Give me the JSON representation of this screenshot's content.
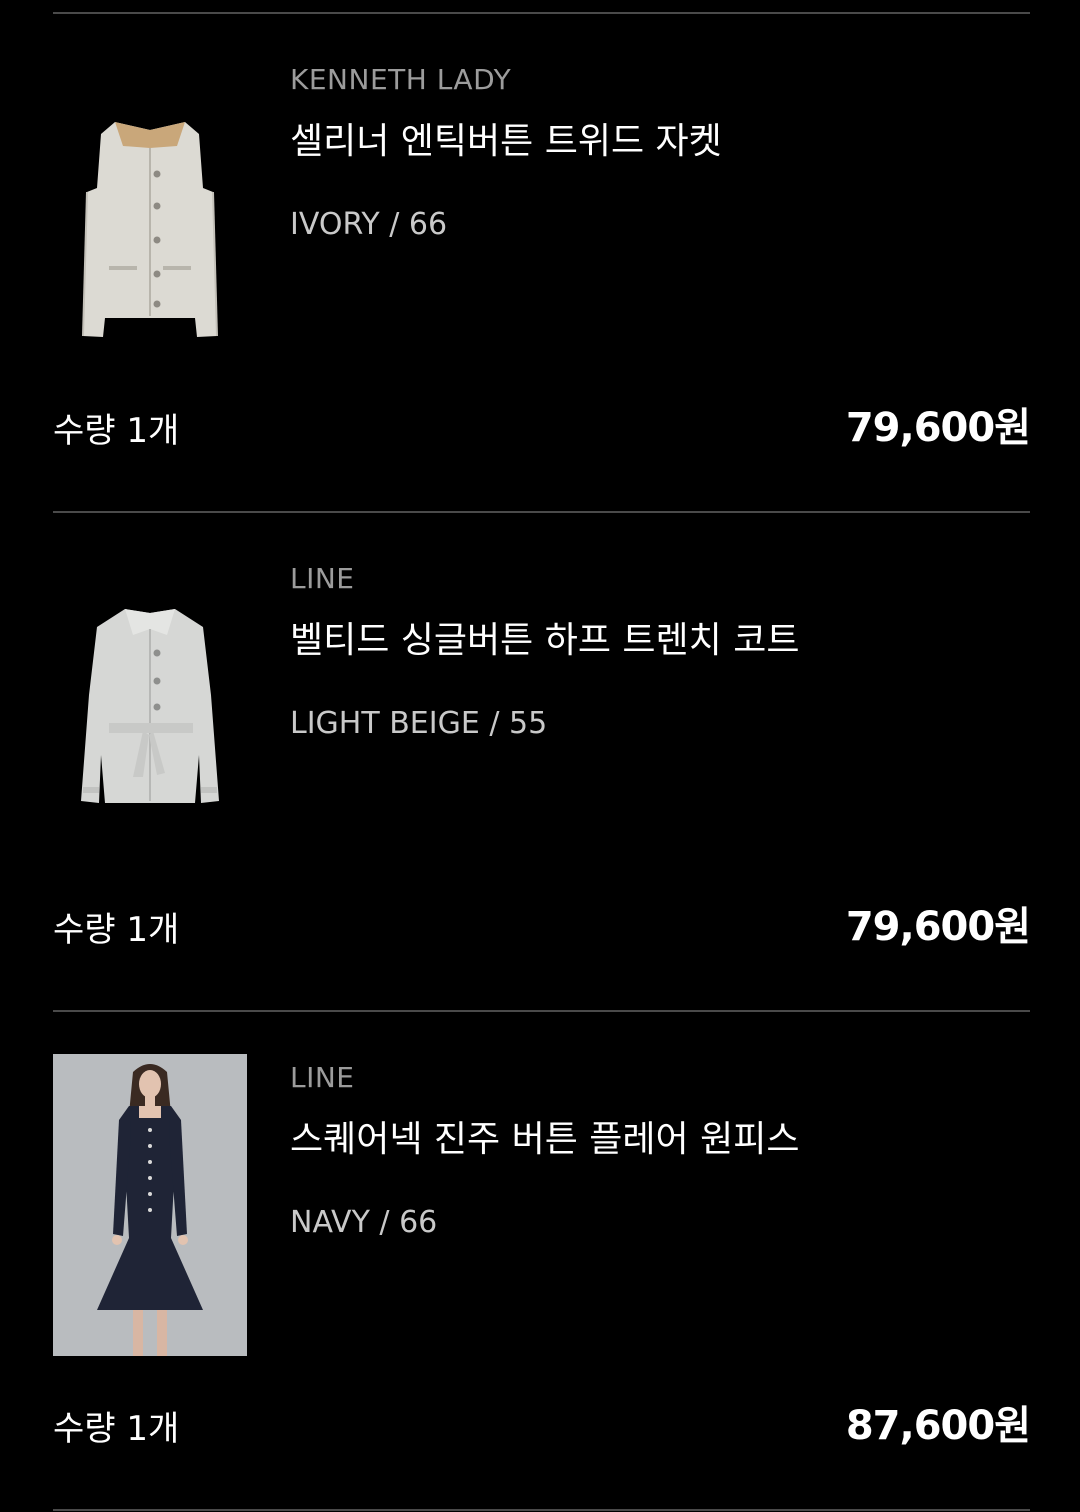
{
  "items": [
    {
      "brand": "KENNETH LADY",
      "name": "셀리너 엔틱버튼 트위드 자켓",
      "option": "IVORY / 66",
      "quantity": "수량 1개",
      "price": "79,600원",
      "image_icon": "ivory-tweed-jacket-image"
    },
    {
      "brand": "LINE",
      "name": "벨티드 싱글버튼 하프 트렌치 코트",
      "option": "LIGHT BEIGE / 55",
      "quantity": "수량 1개",
      "price": "79,600원",
      "image_icon": "beige-trench-coat-image"
    },
    {
      "brand": "LINE",
      "name": "스퀘어넥 진주 버튼 플레어 원피스",
      "option": "NAVY / 66",
      "quantity": "수량 1개",
      "price": "87,600원",
      "image_icon": "navy-dress-model-image"
    }
  ],
  "colors": {
    "background": "#000000",
    "divider": "#4a4a4a",
    "brand_text": "#9c9c9c",
    "option_text": "#c9c9c9",
    "primary_text": "#ffffff"
  }
}
